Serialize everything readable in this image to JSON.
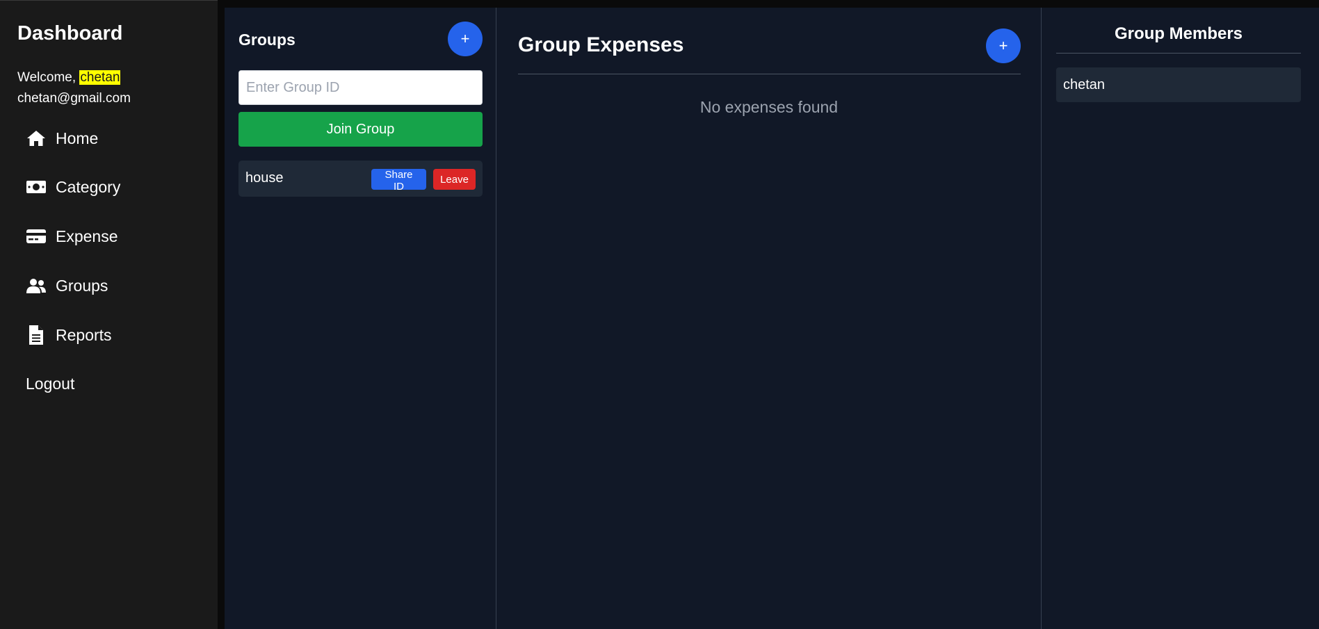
{
  "sidebar": {
    "title": "Dashboard",
    "welcome_prefix": "Welcome, ",
    "username": "chetan",
    "email": "chetan@gmail.com",
    "items": [
      {
        "label": "Home",
        "icon": "home-icon"
      },
      {
        "label": "Category",
        "icon": "money-icon"
      },
      {
        "label": "Expense",
        "icon": "credit-card-icon"
      },
      {
        "label": "Groups",
        "icon": "users-icon"
      },
      {
        "label": "Reports",
        "icon": "file-icon"
      }
    ],
    "logout_label": "Logout"
  },
  "groups": {
    "title": "Groups",
    "add_label": "+",
    "input_placeholder": "Enter Group ID",
    "join_label": "Join Group",
    "list": [
      {
        "name": "house",
        "share_label": "Share ID",
        "leave_label": "Leave"
      }
    ]
  },
  "expenses": {
    "title": "Group Expenses",
    "add_label": "+",
    "empty_text": "No expenses found"
  },
  "members": {
    "title": "Group Members",
    "list": [
      "chetan"
    ]
  },
  "colors": {
    "accent_blue": "#2563eb",
    "success_green": "#16a34a",
    "danger_red": "#dc2626",
    "highlight_yellow": "#ffff00",
    "panel_bg": "#111827",
    "sidebar_bg": "#1a1a1a"
  }
}
